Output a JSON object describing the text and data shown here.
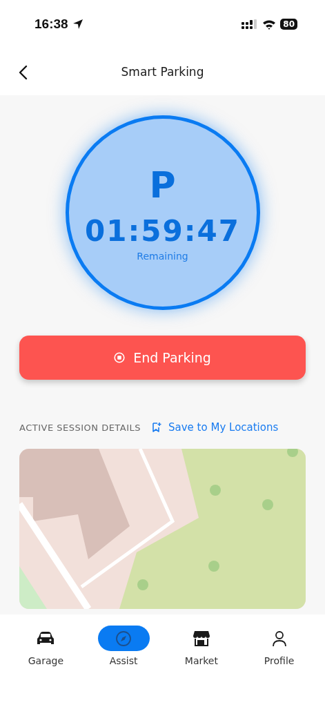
{
  "status_bar": {
    "time": "16:38",
    "battery": "80"
  },
  "nav": {
    "title": "Smart Parking"
  },
  "timer": {
    "letter": "P",
    "time": "01:59:47",
    "caption": "Remaining"
  },
  "end_button": {
    "label": "End Parking"
  },
  "section": {
    "heading": "ACTIVE SESSION DETAILS",
    "action": "Save to My Locations"
  },
  "tabs": [
    {
      "label": "Garage",
      "kind": "car",
      "selected": false
    },
    {
      "label": "Assist",
      "kind": "compass",
      "selected": true
    },
    {
      "label": "Market",
      "kind": "store",
      "selected": false
    },
    {
      "label": "Profile",
      "kind": "person",
      "selected": false
    }
  ]
}
